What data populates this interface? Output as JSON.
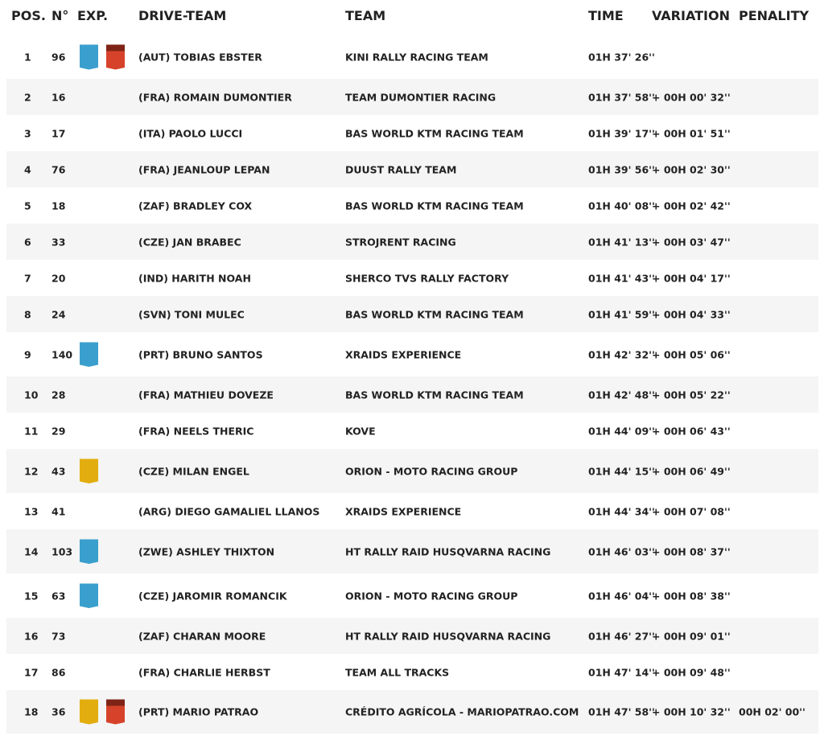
{
  "headers": {
    "pos": "POS.",
    "num": "N°",
    "exp": "EXP.",
    "driver": "DRIVE-TEAM",
    "team": "TEAM",
    "time": "TIME",
    "variation": "VARIATION",
    "penalty": "PENALITY"
  },
  "colors": {
    "blue_badge": "#3a9fcc",
    "yellow_badge": "#e2ad0e",
    "red_badge": "#d6432a",
    "row_alt": "#f5f5f5"
  },
  "rows": [
    {
      "pos": "1",
      "num": "96",
      "badges": [
        "blue-badge",
        "red-badge"
      ],
      "driver": "(AUT)  TOBIAS EBSTER",
      "team": "KINI RALLY RACING TEAM",
      "time": "01H 37' 26''",
      "variation": "",
      "penalty": ""
    },
    {
      "pos": "2",
      "num": "16",
      "badges": [],
      "driver": "(FRA)  ROMAIN DUMONTIER",
      "team": "TEAM DUMONTIER RACING",
      "time": "01H 37' 58''",
      "variation": "+ 00H 00' 32''",
      "penalty": ""
    },
    {
      "pos": "3",
      "num": "17",
      "badges": [],
      "driver": "(ITA)  PAOLO LUCCI",
      "team": "BAS WORLD KTM RACING TEAM",
      "time": "01H 39' 17''",
      "variation": "+ 00H 01' 51''",
      "penalty": ""
    },
    {
      "pos": "4",
      "num": "76",
      "badges": [],
      "driver": "(FRA)  JEANLOUP LEPAN",
      "team": "DUUST RALLY TEAM",
      "time": "01H 39' 56''",
      "variation": "+ 00H 02' 30''",
      "penalty": ""
    },
    {
      "pos": "5",
      "num": "18",
      "badges": [],
      "driver": "(ZAF)  BRADLEY COX",
      "team": "BAS WORLD KTM RACING TEAM",
      "time": "01H 40' 08''",
      "variation": "+ 00H 02' 42''",
      "penalty": ""
    },
    {
      "pos": "6",
      "num": "33",
      "badges": [],
      "driver": "(CZE)  JAN BRABEC",
      "team": "STROJRENT RACING",
      "time": "01H 41' 13''",
      "variation": "+ 00H 03' 47''",
      "penalty": ""
    },
    {
      "pos": "7",
      "num": "20",
      "badges": [],
      "driver": "(IND)  HARITH NOAH",
      "team": "SHERCO TVS RALLY FACTORY",
      "time": "01H 41' 43''",
      "variation": "+ 00H 04' 17''",
      "penalty": ""
    },
    {
      "pos": "8",
      "num": "24",
      "badges": [],
      "driver": "(SVN)  TONI MULEC",
      "team": "BAS WORLD KTM RACING TEAM",
      "time": "01H 41' 59''",
      "variation": "+ 00H 04' 33''",
      "penalty": ""
    },
    {
      "pos": "9",
      "num": "140",
      "badges": [
        "blue-badge"
      ],
      "driver": "(PRT)  BRUNO SANTOS",
      "team": "XRAIDS EXPERIENCE",
      "time": "01H 42' 32''",
      "variation": "+ 00H 05' 06''",
      "penalty": ""
    },
    {
      "pos": "10",
      "num": "28",
      "badges": [],
      "driver": "(FRA)  MATHIEU DOVEZE",
      "team": "BAS WORLD KTM RACING TEAM",
      "time": "01H 42' 48''",
      "variation": "+ 00H 05' 22''",
      "penalty": ""
    },
    {
      "pos": "11",
      "num": "29",
      "badges": [],
      "driver": "(FRA)  NEELS THERIC",
      "team": "KOVE",
      "time": "01H 44' 09''",
      "variation": "+ 00H 06' 43''",
      "penalty": ""
    },
    {
      "pos": "12",
      "num": "43",
      "badges": [
        "yellow-badge"
      ],
      "driver": "(CZE)  MILAN ENGEL",
      "team": "ORION - MOTO RACING GROUP",
      "time": "01H 44' 15''",
      "variation": "+ 00H 06' 49''",
      "penalty": ""
    },
    {
      "pos": "13",
      "num": "41",
      "badges": [],
      "driver": "(ARG)  DIEGO GAMALIEL LLANOS",
      "team": "XRAIDS EXPERIENCE",
      "time": "01H 44' 34''",
      "variation": "+ 00H 07' 08''",
      "penalty": ""
    },
    {
      "pos": "14",
      "num": "103",
      "badges": [
        "blue-badge"
      ],
      "driver": "(ZWE)  ASHLEY THIXTON",
      "team": "HT RALLY RAID HUSQVARNA RACING",
      "time": "01H 46' 03''",
      "variation": "+ 00H 08' 37''",
      "penalty": ""
    },
    {
      "pos": "15",
      "num": "63",
      "badges": [
        "blue-badge"
      ],
      "driver": "(CZE)  JAROMIR ROMANCIK",
      "team": "ORION - MOTO RACING GROUP",
      "time": "01H 46' 04''",
      "variation": "+ 00H 08' 38''",
      "penalty": ""
    },
    {
      "pos": "16",
      "num": "73",
      "badges": [],
      "driver": "(ZAF)  CHARAN MOORE",
      "team": "HT RALLY RAID HUSQVARNA RACING",
      "time": "01H 46' 27''",
      "variation": "+ 00H 09' 01''",
      "penalty": ""
    },
    {
      "pos": "17",
      "num": "86",
      "badges": [],
      "driver": "(FRA)  CHARLIE HERBST",
      "team": "TEAM ALL TRACKS",
      "time": "01H 47' 14''",
      "variation": "+ 00H 09' 48''",
      "penalty": ""
    },
    {
      "pos": "18",
      "num": "36",
      "badges": [
        "yellow-badge",
        "red-badge"
      ],
      "driver": "(PRT)  MARIO PATRAO",
      "team": "CRÉDITO AGRÍCOLA - MARIOPATRAO.COM",
      "time": "01H 47' 58''",
      "variation": "+ 00H 10' 32''",
      "penalty": "00H 02' 00''"
    }
  ]
}
